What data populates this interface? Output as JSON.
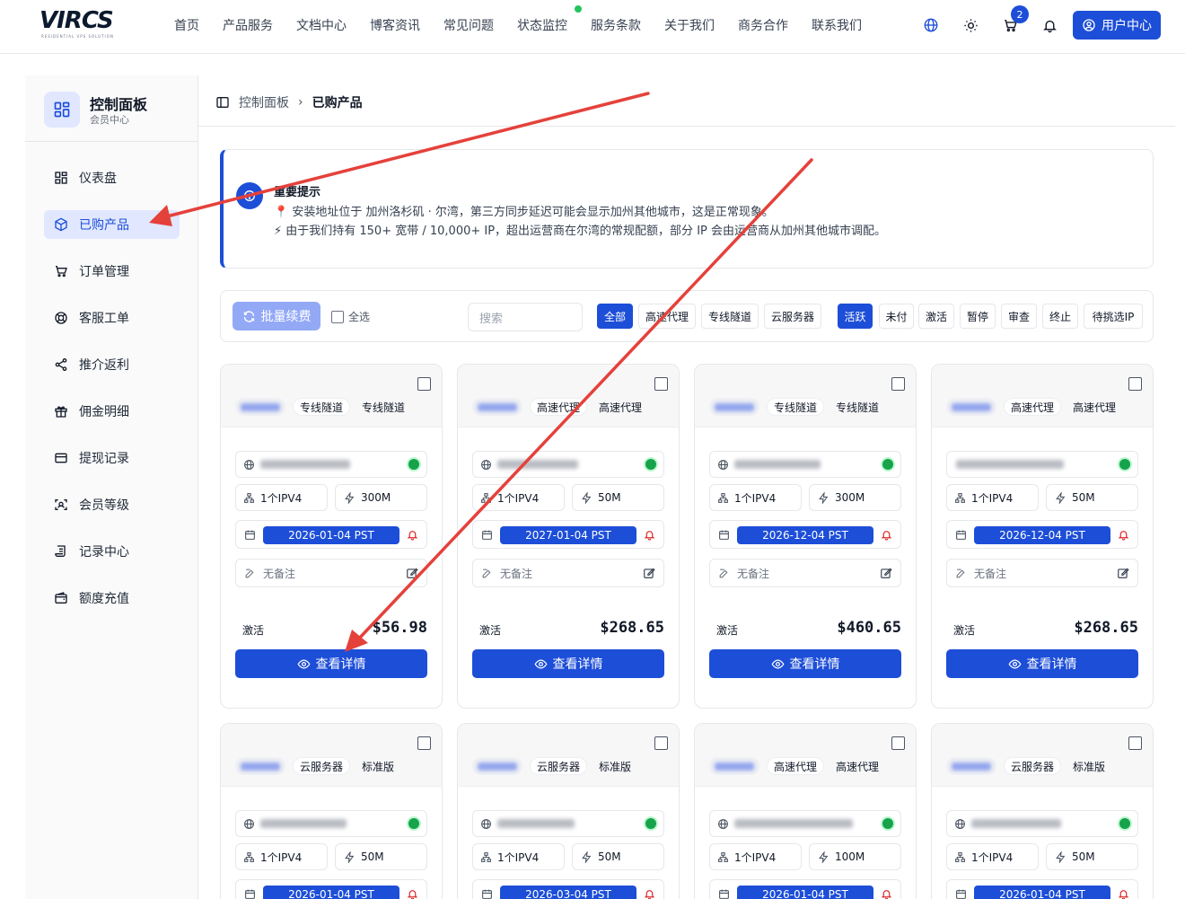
{
  "header": {
    "logo_text": "VIRCS",
    "logo_subtitle": "RESIDENTIAL VPS SOLUTION",
    "nav": [
      "首页",
      "产品服务",
      "文档中心",
      "博客资讯",
      "常见问题",
      "状态监控",
      "服务条款",
      "关于我们",
      "商务合作",
      "联系我们"
    ],
    "cart_count": "2",
    "user_button": "用户中心"
  },
  "sidebar": {
    "title": "控制面板",
    "subtitle": "会员中心",
    "items": [
      {
        "label": "仪表盘",
        "icon": "grid-icon"
      },
      {
        "label": "已购产品",
        "icon": "cube-icon",
        "active": true
      },
      {
        "label": "订单管理",
        "icon": "cart-icon"
      },
      {
        "label": "客服工单",
        "icon": "lifebuoy-icon"
      },
      {
        "label": "推介返利",
        "icon": "share-icon"
      },
      {
        "label": "佣金明细",
        "icon": "gift-icon"
      },
      {
        "label": "提现记录",
        "icon": "card-icon"
      },
      {
        "label": "会员等级",
        "icon": "scan-icon"
      },
      {
        "label": "记录中心",
        "icon": "scroll-icon"
      },
      {
        "label": "额度充值",
        "icon": "wallet-icon"
      }
    ]
  },
  "breadcrumb": {
    "root": "控制面板",
    "separator": "›",
    "current": "已购产品"
  },
  "notice": {
    "title": "重要提示",
    "line1": "📍 安装地址位于 加州洛杉矶 · 尔湾，第三方同步延迟可能会显示加州其他城市，这是正常现象。",
    "line2": "⚡ 由于我们持有 150+ 宽带 / 10,000+ IP，超出运营商在尔湾的常规配额，部分 IP 会由运营商从加州其他城市调配。"
  },
  "filter": {
    "renew_button": "批量续费",
    "select_all": "全选",
    "search_placeholder": "搜索",
    "type_chips": [
      "全部",
      "高速代理",
      "专线隧道",
      "云服务器"
    ],
    "status_chips": [
      "活跃",
      "未付",
      "激活",
      "暂停",
      "审查",
      "终止",
      "待挑选IP"
    ]
  },
  "cards": [
    {
      "tag1": "专线隧道",
      "tag2": "专线隧道",
      "ip_count": "1个IPV4",
      "bandwidth": "300M",
      "expiry": "2026-01-04 PST",
      "remark": "无备注",
      "status": "激活",
      "price": "$56.98",
      "detail": "查看详情"
    },
    {
      "tag1": "高速代理",
      "tag2": "高速代理",
      "ip_count": "1个IPV4",
      "bandwidth": "50M",
      "expiry": "2027-01-04 PST",
      "remark": "无备注",
      "status": "激活",
      "price": "$268.65",
      "detail": "查看详情"
    },
    {
      "tag1": "专线隧道",
      "tag2": "专线隧道",
      "ip_count": "1个IPV4",
      "bandwidth": "300M",
      "expiry": "2026-12-04 PST",
      "remark": "无备注",
      "status": "激活",
      "price": "$460.65",
      "detail": "查看详情"
    },
    {
      "tag1": "高速代理",
      "tag2": "高速代理",
      "ip_count": "1个IPV4",
      "bandwidth": "50M",
      "expiry": "2026-12-04 PST",
      "remark": "无备注",
      "status": "激活",
      "price": "$268.65",
      "detail": "查看详情"
    },
    {
      "tag1": "云服务器",
      "tag2": "标准版",
      "ip_count": "1个IPV4",
      "bandwidth": "50M",
      "expiry": "2026-01-04 PST"
    },
    {
      "tag1": "云服务器",
      "tag2": "标准版",
      "ip_count": "1个IPV4",
      "bandwidth": "50M",
      "expiry": "2026-03-04 PST"
    },
    {
      "tag1": "高速代理",
      "tag2": "高速代理",
      "ip_count": "1个IPV4",
      "bandwidth": "100M",
      "expiry": "2026-01-04 PST"
    },
    {
      "tag1": "云服务器",
      "tag2": "标准版",
      "ip_count": "1个IPV4",
      "bandwidth": "50M",
      "expiry": "2026-01-04 PST"
    }
  ],
  "colors": {
    "accent": "#1d4ed8",
    "annotation_arrow": "#e5413b",
    "online": "#16a34a"
  }
}
